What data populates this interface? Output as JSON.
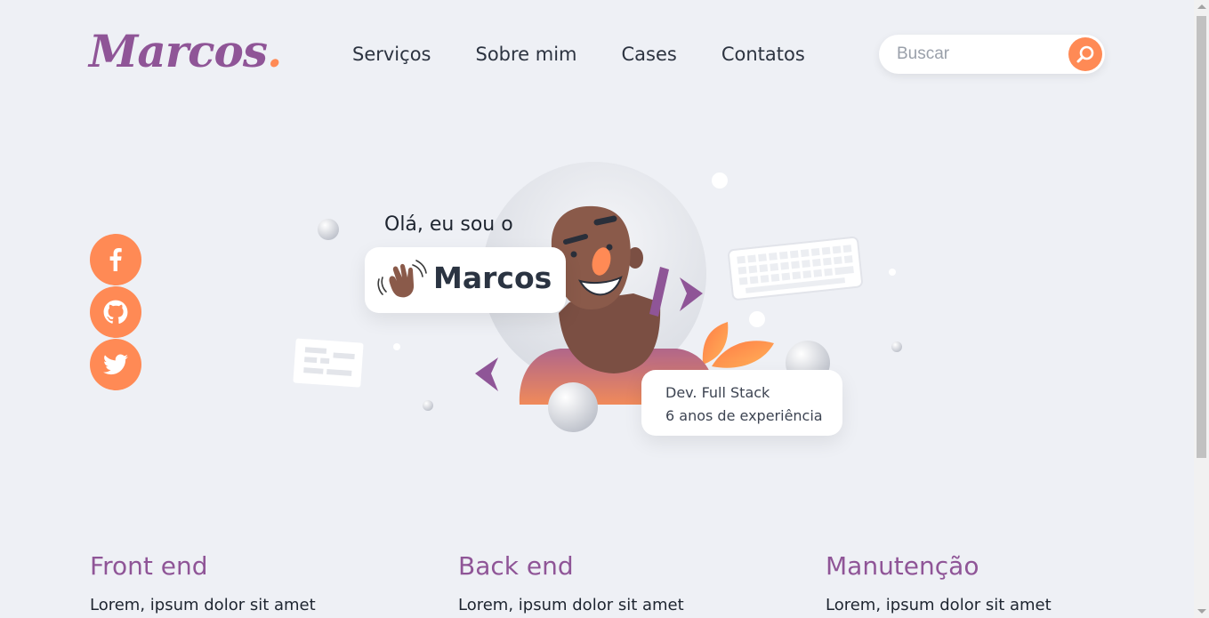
{
  "header": {
    "logo_text": "Marcos",
    "logo_dot": ".",
    "nav": [
      "Serviços",
      "Sobre mim",
      "Cases",
      "Contatos"
    ],
    "search_placeholder": "Buscar"
  },
  "social": {
    "icons": [
      "facebook-icon",
      "github-icon",
      "twitter-icon"
    ]
  },
  "hero": {
    "greeting": "Olá, eu sou o",
    "name": "Marcos",
    "role": "Dev. Full Stack",
    "experience": "6 anos de experiência"
  },
  "services": [
    {
      "title": "Front end",
      "text": "Lorem, ipsum dolor sit amet"
    },
    {
      "title": "Back end",
      "text": "Lorem, ipsum dolor sit amet"
    },
    {
      "title": "Manutenção",
      "text": "Lorem, ipsum dolor sit amet"
    }
  ],
  "colors": {
    "background": "#eef0f5",
    "primary_purple": "#8f5597",
    "accent_orange": "#ff8a55",
    "text_dark": "#2c3340"
  }
}
